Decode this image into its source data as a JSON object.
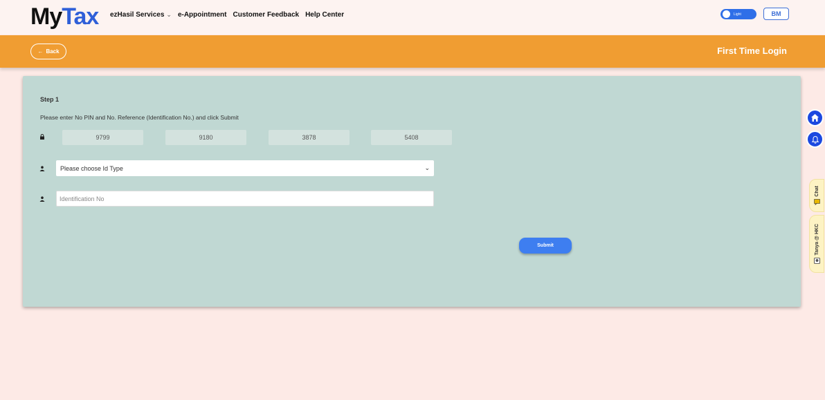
{
  "header": {
    "logo_my": "My",
    "logo_tax": "Tax",
    "menu": [
      {
        "label": "ezHasil Services",
        "has_dropdown": true
      },
      {
        "label": "e-Appointment"
      },
      {
        "label": "Customer Feedback"
      },
      {
        "label": "Help Center"
      }
    ],
    "theme_toggle_label": "Light",
    "language_button": "BM"
  },
  "bar": {
    "back_label": "Back",
    "page_title": "First Time Login"
  },
  "form": {
    "step_title": "Step 1",
    "instruction": "Please enter No PIN and No. Reference (Identification No.) and click Submit",
    "pin_segments": [
      "9799",
      "9180",
      "3878",
      "5408"
    ],
    "id_type_select": "Please choose Id Type",
    "id_number_placeholder": "Identification No",
    "submit_label": "Submit"
  },
  "side": {
    "chat_label": "Chat",
    "tanya_label": "Tanya @ HKC"
  },
  "colors": {
    "accent_orange": "#f09d32",
    "primary_blue": "#3e7ef0",
    "card_bg": "#c0d8d3",
    "page_bg": "#fdeae6"
  }
}
